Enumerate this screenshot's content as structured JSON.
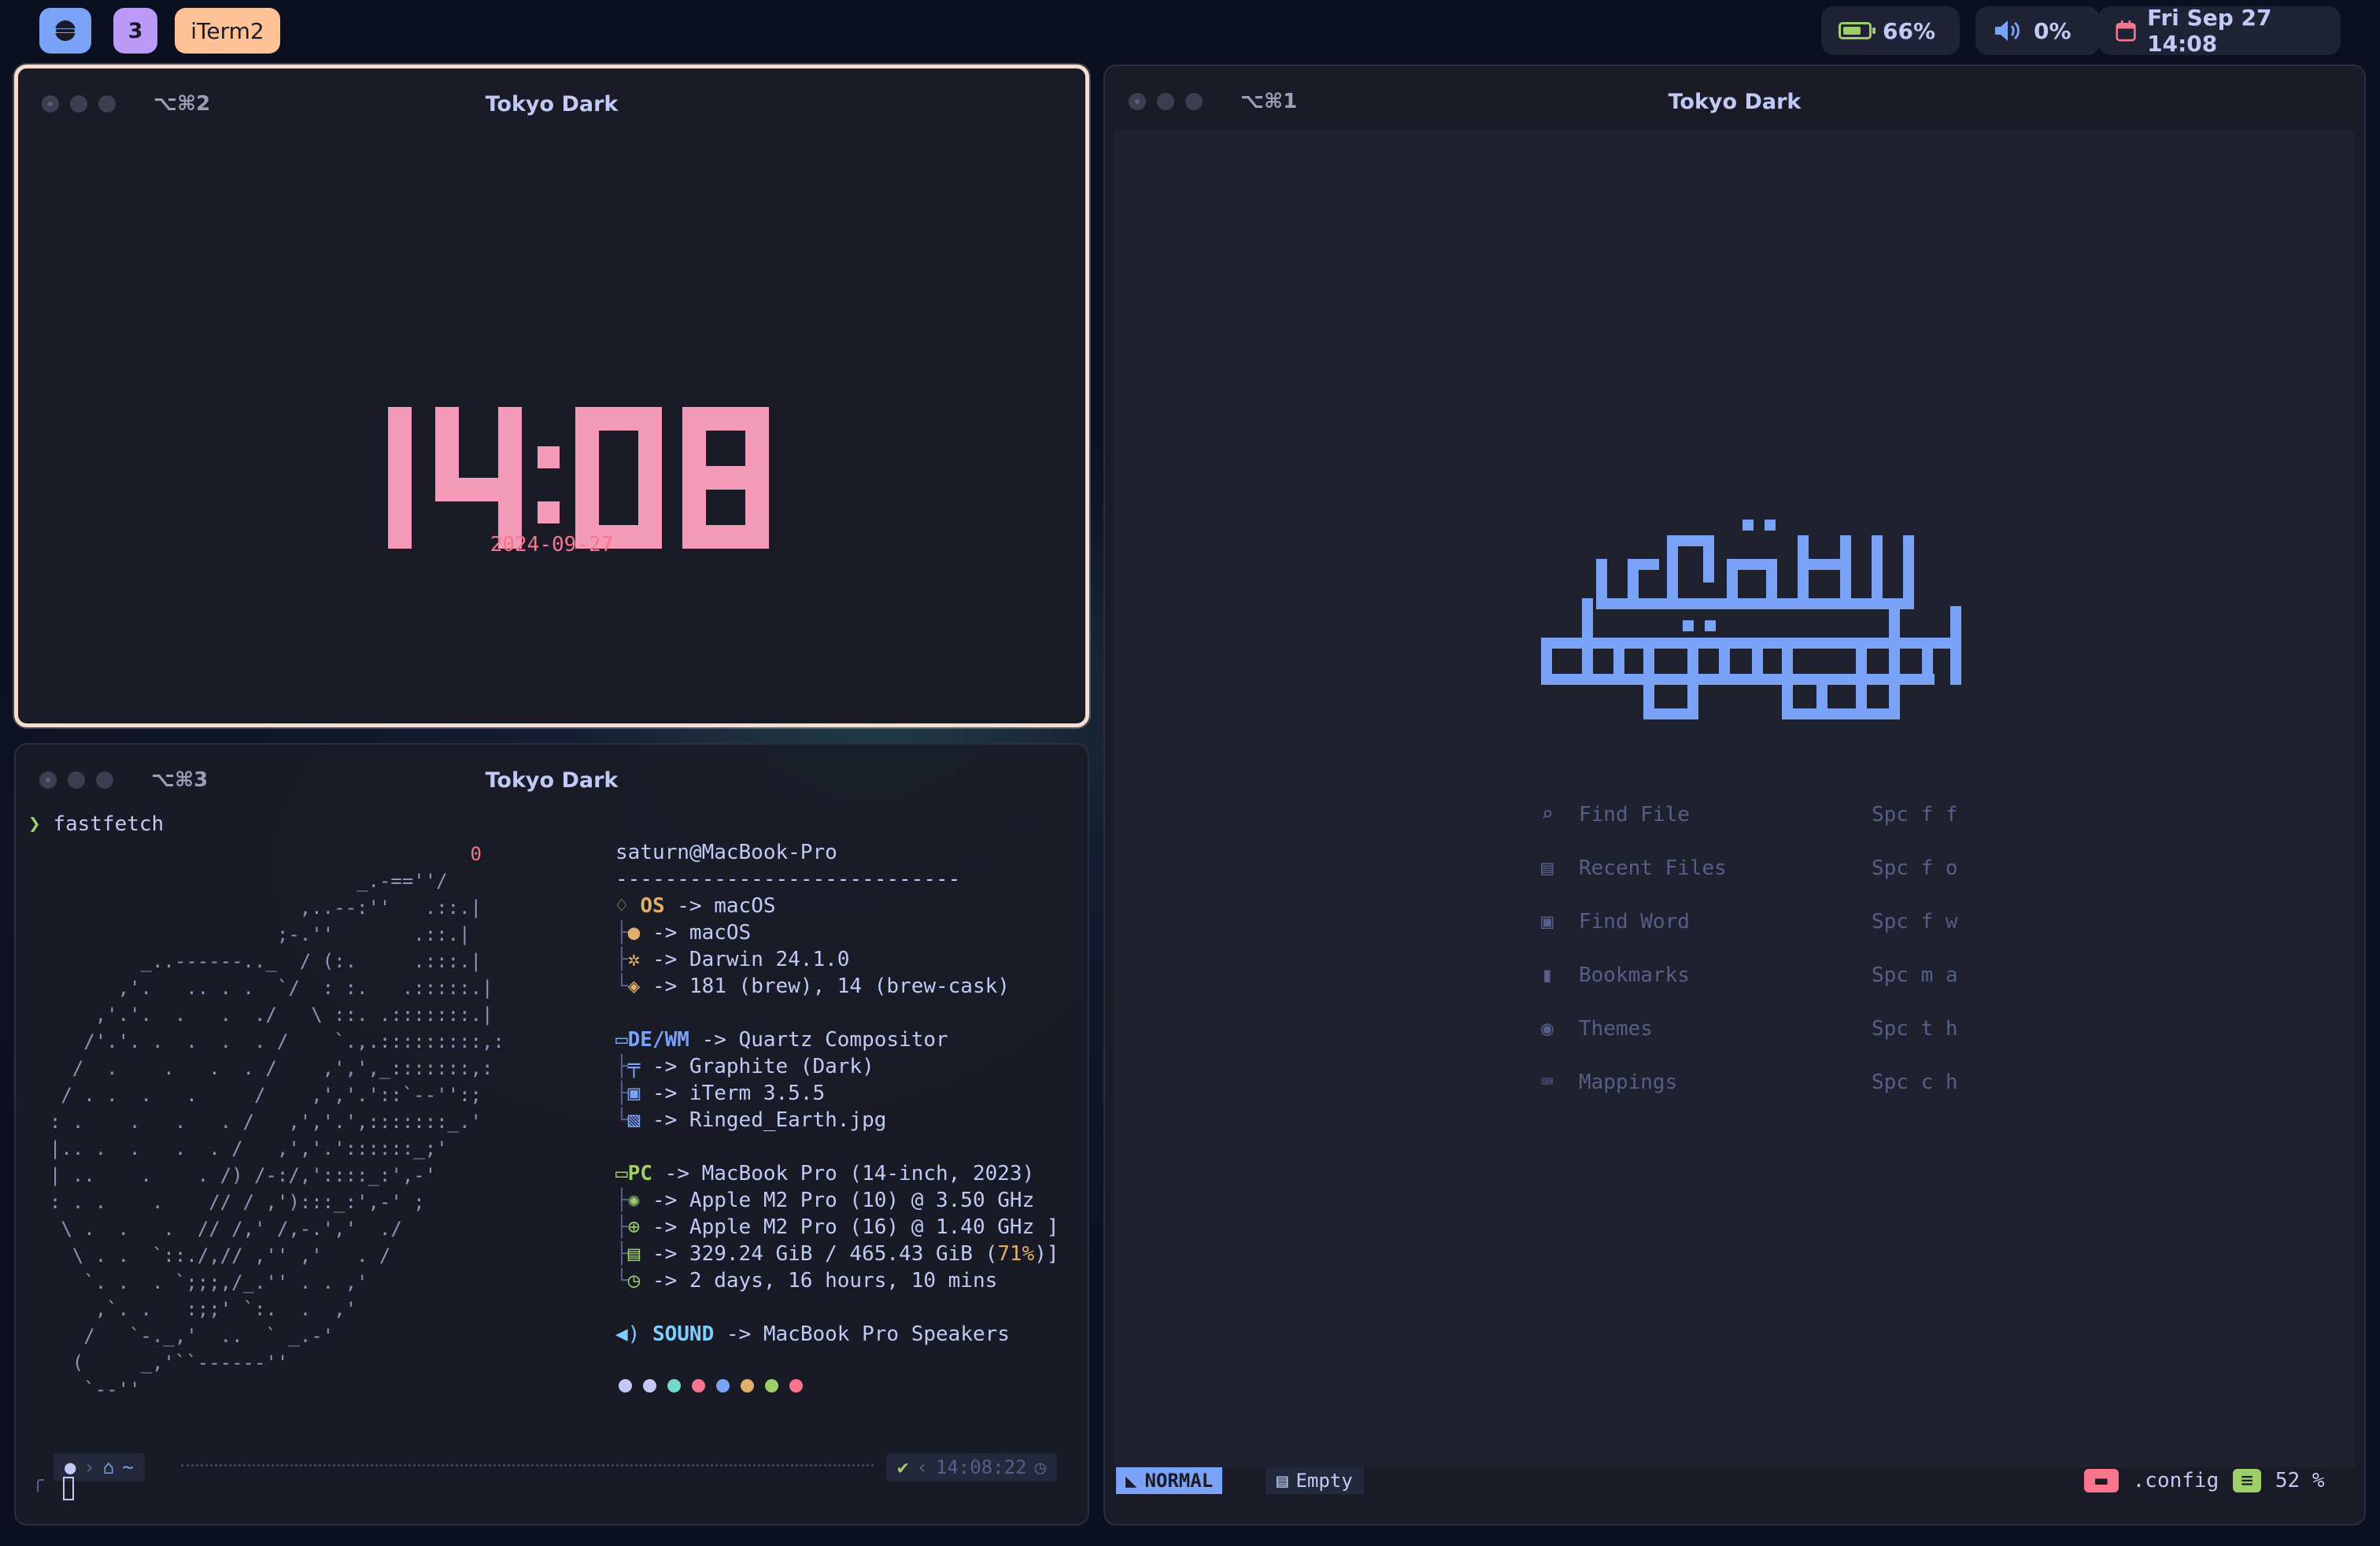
{
  "topbar": {
    "workspace_number": "3",
    "front_app": "iTerm2",
    "battery": "66%",
    "battery_level": 0.66,
    "volume": "0%",
    "datetime": "Fri Sep 27 14:08",
    "colors": {
      "workspace": "#7aa2f7",
      "number": "#bb9af7",
      "app": "#ffc297",
      "battery": "#9ece6a",
      "volume": "#7aa2f7",
      "calendar": "#f7768e"
    }
  },
  "clock_window": {
    "shortcut": "⌥⌘2",
    "title": "Tokyo Dark",
    "time": "14:08",
    "date": "2024-09-27"
  },
  "terminal_window": {
    "shortcut": "⌥⌘3",
    "title": "Tokyo Dark",
    "prompt_symbol": "❯",
    "command": "fastfetch",
    "ascii_marker": "0",
    "user_host": "saturn@MacBook-Pro",
    "separator": "----------------------------",
    "os_label": "OS",
    "os_value": "-> macOS",
    "os_items": [
      "-> macOS",
      "-> Darwin 24.1.0",
      "-> 181 (brew), 14 (brew-cask)"
    ],
    "de_label": "DE/WM",
    "de_value": "-> Quartz Compositor",
    "de_items": [
      "-> Graphite (Dark)",
      "-> iTerm 3.5.5",
      "-> Ringed_Earth.jpg"
    ],
    "pc_label": "PC",
    "pc_value": "-> MacBook Pro (14-inch, 2023)",
    "pc_items": [
      "-> Apple M2 Pro (10) @ 3.50 GHz",
      "-> Apple M2 Pro (16) @ 1.40 GHz ]",
      "-> 329.24 GiB / 465.43 GiB (",
      "71%",
      ")]",
      "-> 2 days, 16 hours, 10 mins"
    ],
    "sound_label": "SOUND",
    "sound_value": "-> MacBook Pro Speakers",
    "palette": [
      "#c0caf5",
      "#c0caf5",
      "#73daca",
      "#f7768e",
      "#7aa2f7",
      "#e0af68",
      "#9ece6a",
      "#f7768e"
    ],
    "prompt_dir": "~",
    "prompt_time": "14:08:22",
    "prompt_status": "✔"
  },
  "nvim_window": {
    "shortcut": "⌥⌘1",
    "title": "Tokyo Dark",
    "menu": [
      {
        "icon": "search-icon",
        "label": "Find File",
        "key": "Spc f f"
      },
      {
        "icon": "recent-files-icon",
        "label": "Recent Files",
        "key": "Spc f o"
      },
      {
        "icon": "word-icon",
        "label": "Find Word",
        "key": "Spc f w"
      },
      {
        "icon": "bookmark-icon",
        "label": "Bookmarks",
        "key": "Spc m a"
      },
      {
        "icon": "palette-icon",
        "label": "Themes",
        "key": "Spc t h"
      },
      {
        "icon": "keyboard-icon",
        "label": "Mappings",
        "key": "Spc c h"
      }
    ],
    "status": {
      "mode": "NORMAL",
      "buffer": "Empty",
      "dir": ".config",
      "percent": "52 %"
    }
  }
}
